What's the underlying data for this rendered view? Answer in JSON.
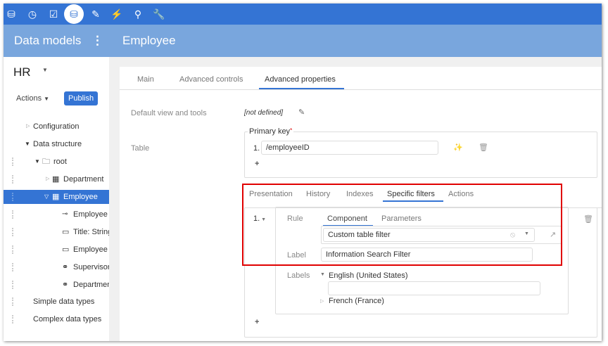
{
  "topbar": {
    "icons": [
      "database-icon",
      "clock-icon",
      "checkbox-icon",
      "database-edit-icon",
      "checklist-edit-icon",
      "plug-icon",
      "search-icon",
      "wrench-icon"
    ],
    "active_index": 3,
    "color": "#3474d4"
  },
  "header": {
    "section": "Data models",
    "title": "Employee"
  },
  "left": {
    "model": "HR",
    "actions_label": "Actions",
    "publish_label": "Publish",
    "tree": [
      {
        "label": "Configuration"
      },
      {
        "label": "Data structure"
      },
      {
        "label": "root"
      },
      {
        "label": "Department"
      },
      {
        "label": "Employee"
      },
      {
        "label": "Employee I"
      },
      {
        "label": "Title: String"
      },
      {
        "label": "Employee N"
      },
      {
        "label": "Supervisor"
      },
      {
        "label": "Departmen"
      },
      {
        "label": "Simple data types"
      },
      {
        "label": "Complex data types"
      }
    ]
  },
  "tabs": [
    "Main",
    "Advanced controls",
    "Advanced properties"
  ],
  "active_tab": 2,
  "props": {
    "default_view_label": "Default view and tools",
    "default_view_value": "[not defined]",
    "table_label": "Table",
    "primary_key_label": "Primary key",
    "required_mark": "*",
    "pk_index": "1.",
    "pk_value": "/employeeID",
    "add": "+"
  },
  "subtabs": [
    "Presentation",
    "History",
    "Indexes",
    "Specific filters",
    "Actions"
  ],
  "active_subtab": 3,
  "filter": {
    "index": "1.",
    "rule_label": "Rule",
    "rule_tabs": [
      "Component",
      "Parameters"
    ],
    "component_value": "Custom table filter",
    "label_label": "Label",
    "label_value": "Information Search Filter",
    "labels_label": "Labels",
    "lang1": "English (United States)",
    "lang1_value": "",
    "lang2": "French (France)",
    "add": "+"
  },
  "highlight_color": "#e00000"
}
